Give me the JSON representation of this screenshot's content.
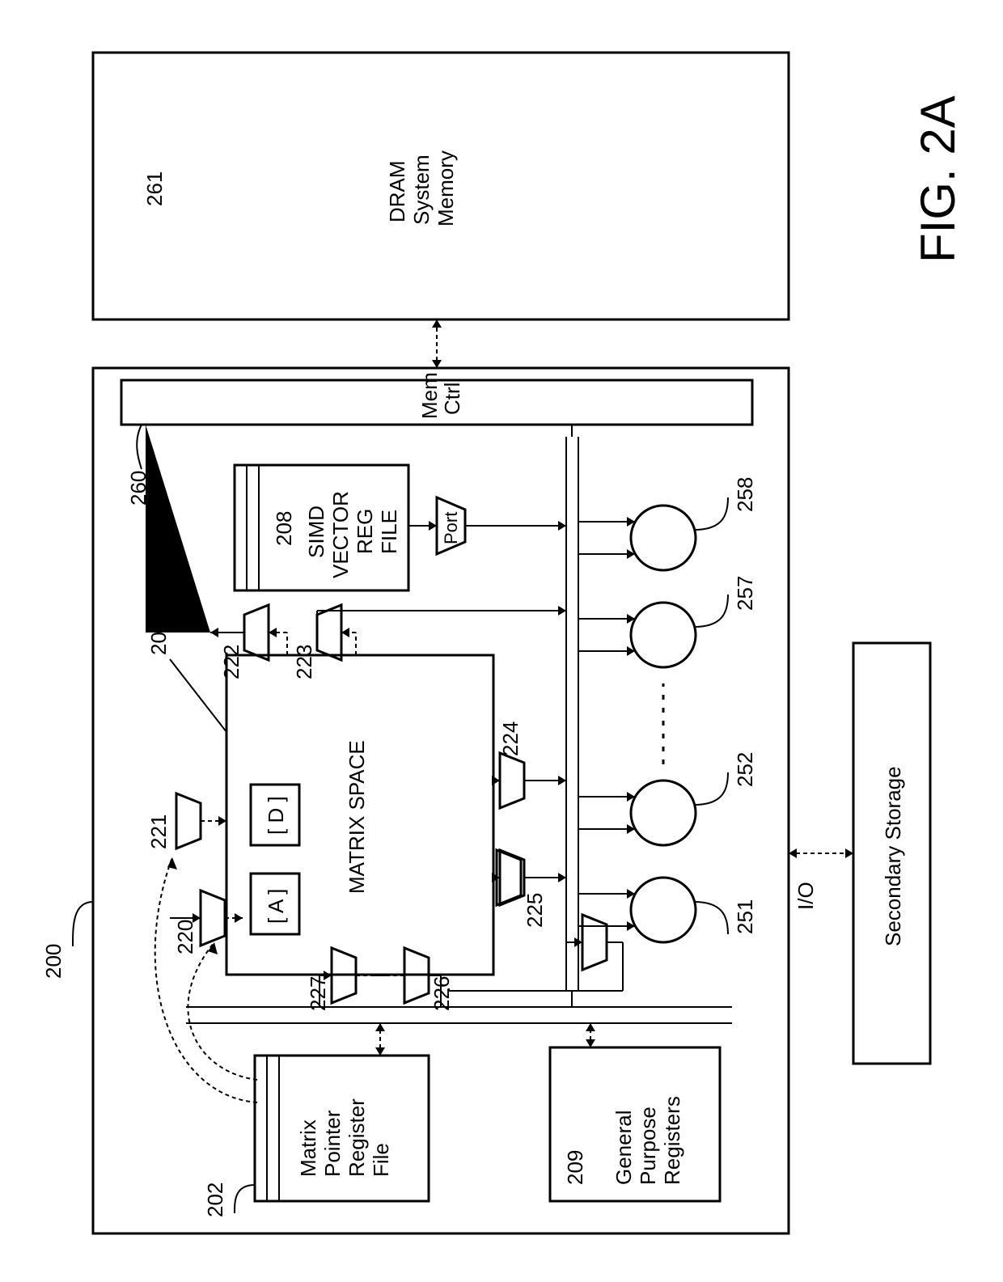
{
  "figure_label": "FIG. 2A",
  "refs": {
    "processor": "200",
    "matrix_space": "201",
    "matrix_ptr_regfile": "202",
    "simd_regfile": "208",
    "gpr": "209",
    "port220": "220",
    "port221": "221",
    "port222": "222",
    "port223": "223",
    "port224": "224",
    "port225": "225",
    "port226": "226",
    "port227": "227",
    "alu251": "251",
    "alu252": "252",
    "alu257": "257",
    "alu258": "258",
    "memctrl": "260",
    "dram": "261"
  },
  "blocks": {
    "matrix_space": "MATRIX SPACE",
    "matrix_a": "[ A ]",
    "matrix_d": "[ D ]",
    "matrix_ptr_regfile": "Matrix\nPointer\nRegister\nFile",
    "simd_regfile": "SIMD\nVECTOR\nREG\nFILE",
    "gpr": "General\nPurpose\nRegisters",
    "memctrl": "Mem\nCtrl",
    "io": "I/O",
    "dram": "DRAM\nSystem\nMemory",
    "secondary_storage": "Secondary Storage",
    "port_label": "Port"
  }
}
